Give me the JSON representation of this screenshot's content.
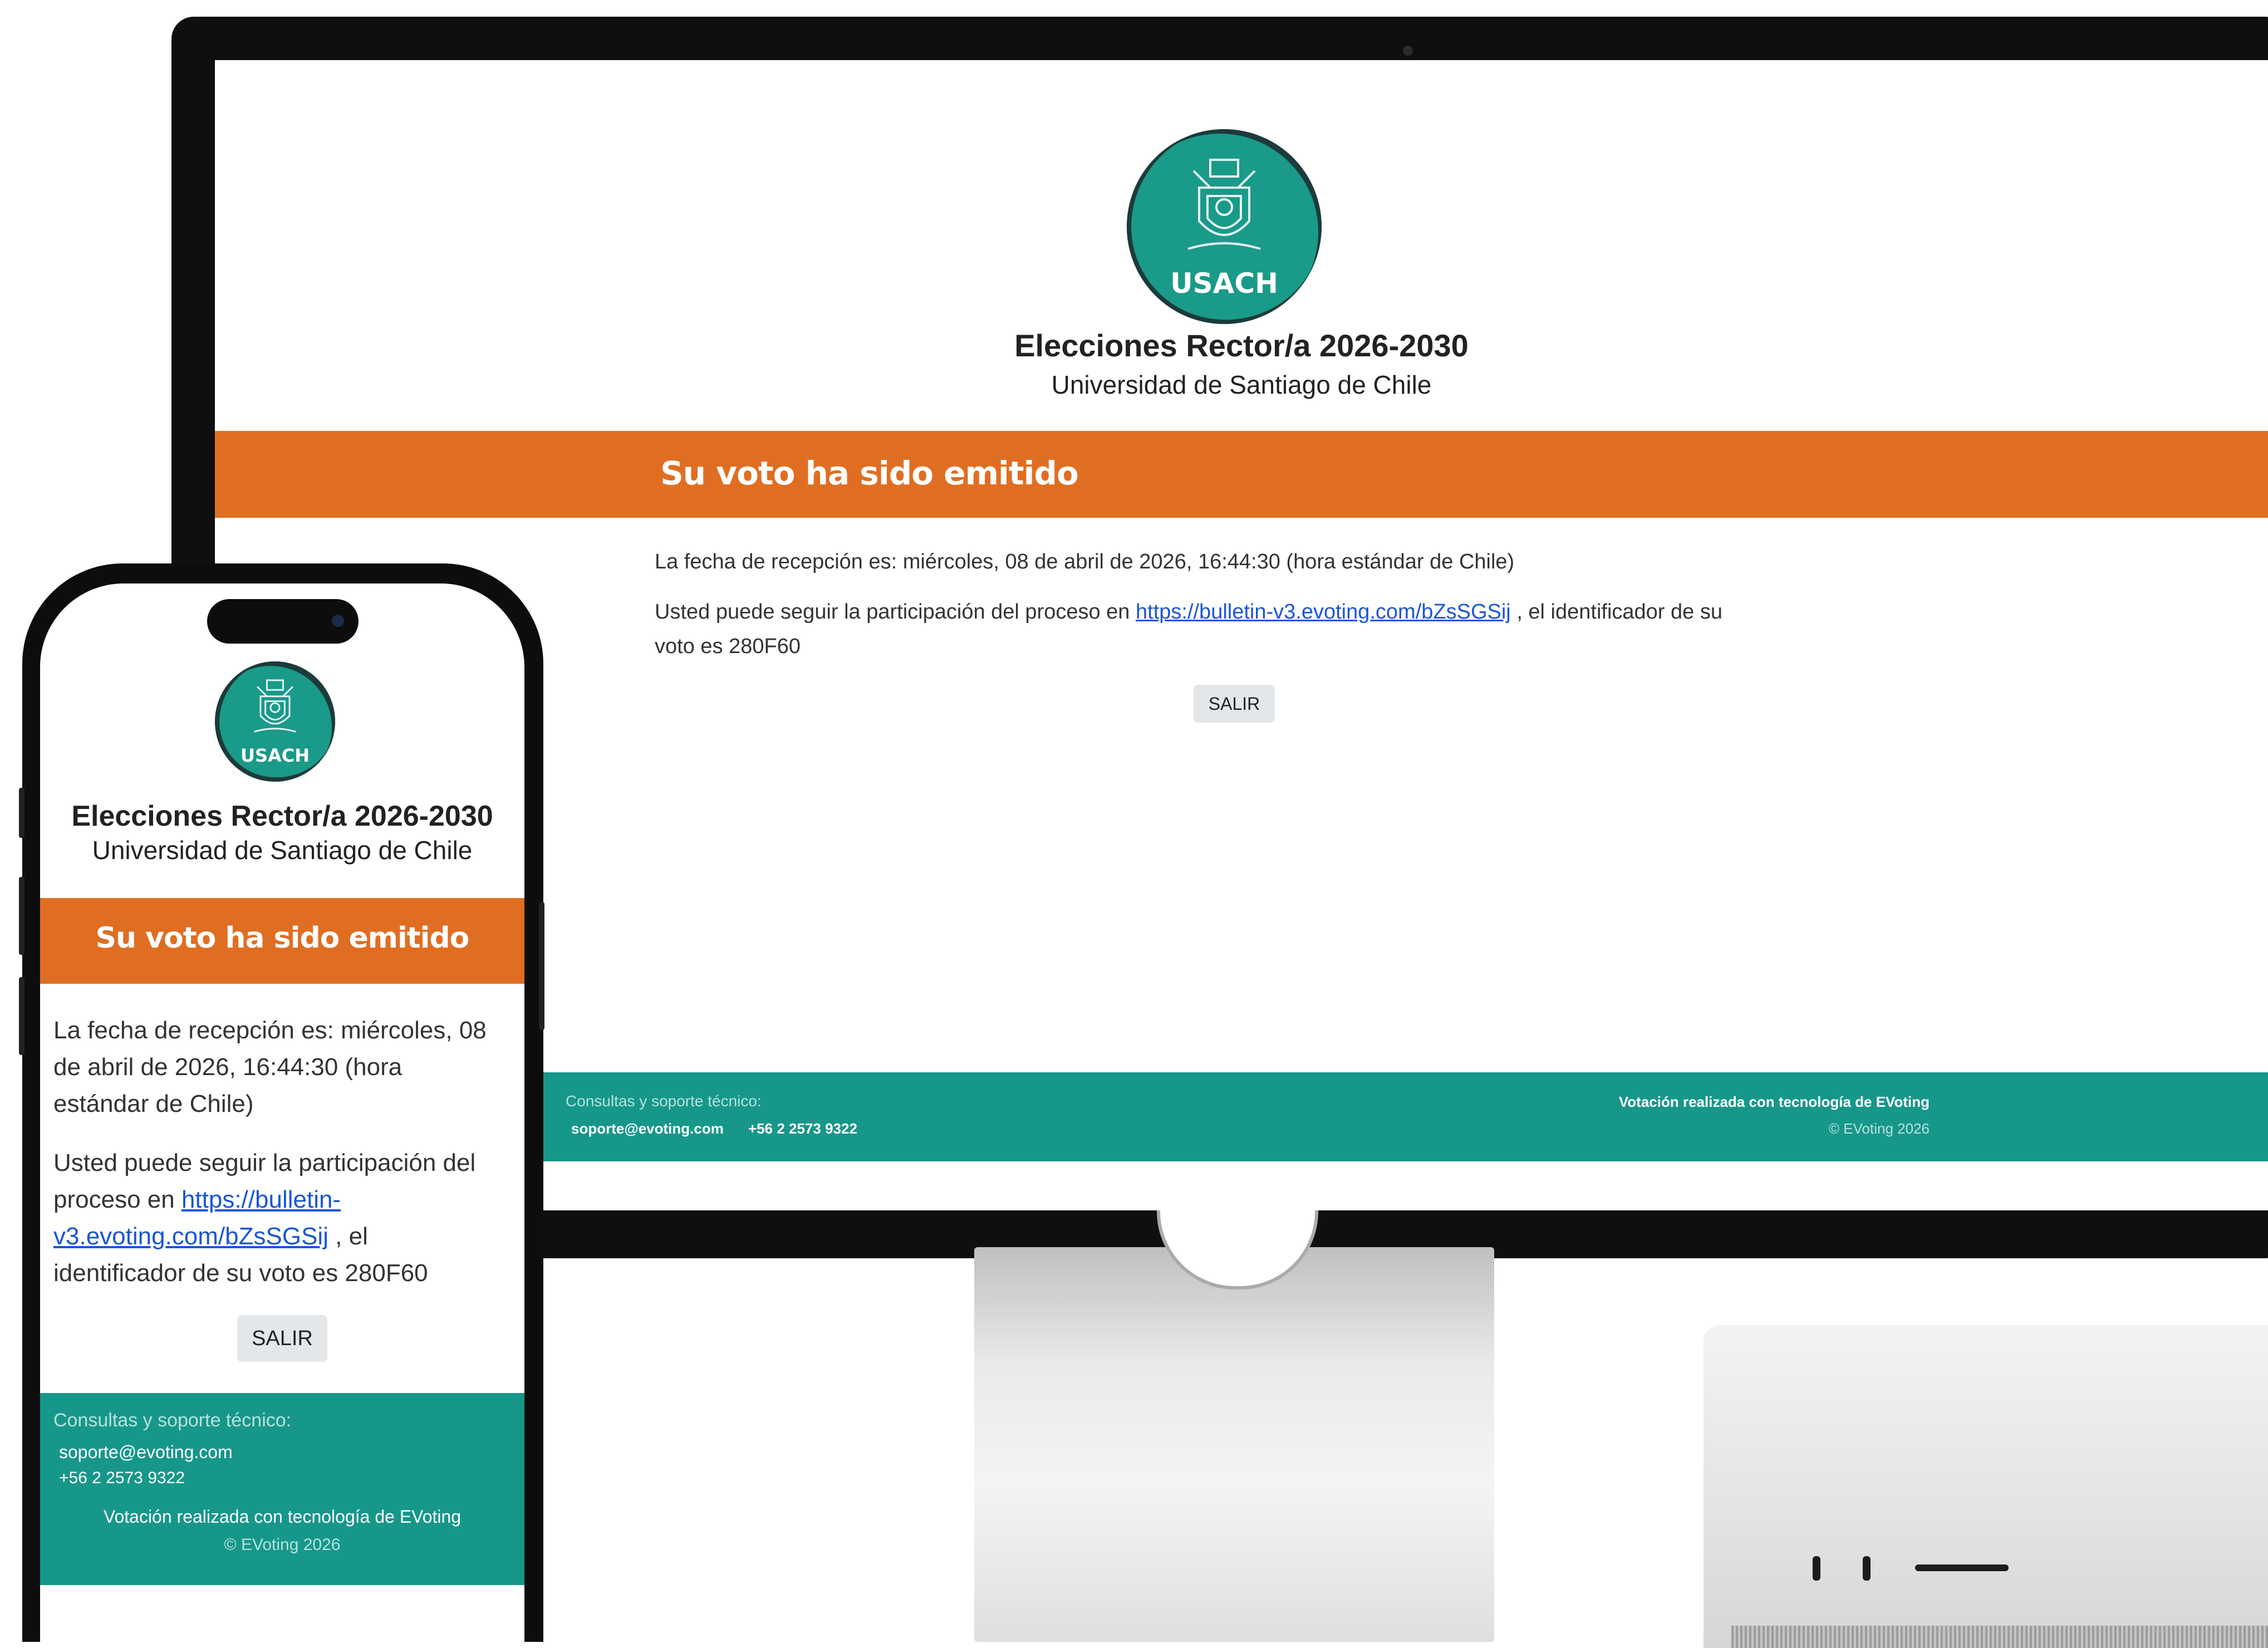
{
  "election": {
    "logo_text": "USACH",
    "title": "Elecciones Rector/a 2026-2030",
    "subtitle": "Universidad de Santiago de Chile"
  },
  "banner": {
    "heading": "Su voto ha sido emitido"
  },
  "content": {
    "reception_text": "La fecha de recepción es: miércoles, 08 de abril de 2026, 16:44:30 (hora estándar de Chile)",
    "reception_phone_1": "La fecha de recepción es: miércoles, 08",
    "reception_phone_2": "de abril de 2026, 16:44:30 (hora",
    "reception_phone_3": "estándar de Chile)",
    "follow_prefix": "Usted puede seguir la participación del proceso en",
    "follow_link": "https://bulletin-v3.evoting.com/bZsSGSij",
    "follow_link_part1": "https://bulletin-",
    "follow_link_part2": "v3.evoting.com/bZsSGSij",
    "follow_suffix_desktop_1": ", el identificador de su",
    "follow_suffix_desktop_2": "voto es 280F60",
    "phone_follow_1": "Usted puede seguir la participación del",
    "phone_follow_2": "proceso en",
    "phone_follow_3": ", el",
    "phone_follow_4": "identificador de su voto es 280F60",
    "exit_label": "SALIR"
  },
  "footer": {
    "support_label": "Consultas y soporte técnico:",
    "email": "soporte@evoting.com",
    "phone": "+56 2 2573 9322",
    "powered_by": "Votación realizada con tecnología de EVoting",
    "copyright": "© EVoting 2026"
  },
  "colors": {
    "teal": "#17978a",
    "orange": "#e06e22",
    "link": "#1a56d6"
  }
}
